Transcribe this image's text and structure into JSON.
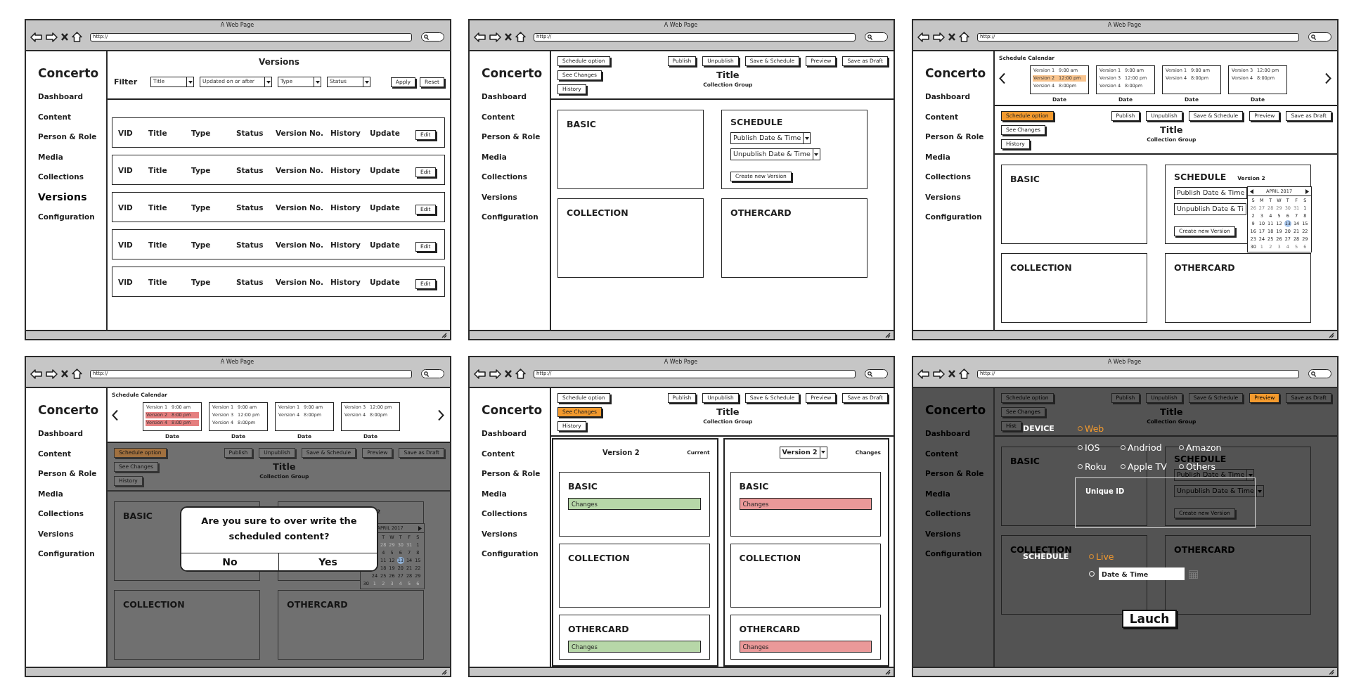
{
  "frames": [
    {
      "kind": "versions",
      "window_title": "A Web Page",
      "url": "http://",
      "sidebar": {
        "brand": "Concerto",
        "items": [
          {
            "label": "Dashboard",
            "selected": false
          },
          {
            "label": "Content",
            "selected": false
          },
          {
            "label": "Person & Role",
            "selected": false
          },
          {
            "label": "Media",
            "selected": false
          },
          {
            "label": "Collections",
            "selected": false
          },
          {
            "label": "Versions",
            "selected": true
          },
          {
            "label": "Configuration",
            "selected": false
          }
        ]
      },
      "header": {
        "title": "Versions",
        "filter_label": "Filter",
        "filters": [
          "Title",
          "Updated on or after",
          "Type",
          "Status"
        ],
        "buttons": [
          "Apply",
          "Reset"
        ]
      },
      "rows": [
        {
          "cells": [
            "VID",
            "Title",
            "Type",
            "Status",
            "Version No.",
            "History",
            "Update"
          ],
          "action": "Edit"
        },
        {
          "cells": [
            "VID",
            "Title",
            "Type",
            "Status",
            "Version No.",
            "History",
            "Update"
          ],
          "action": "Edit"
        },
        {
          "cells": [
            "VID",
            "Title",
            "Type",
            "Status",
            "Version No.",
            "History",
            "Update"
          ],
          "action": "Edit"
        },
        {
          "cells": [
            "VID",
            "Title",
            "Type",
            "Status",
            "Version No.",
            "History",
            "Update"
          ],
          "action": "Edit"
        },
        {
          "cells": [
            "VID",
            "Title",
            "Type",
            "Status",
            "Version No.",
            "History",
            "Update"
          ],
          "action": "Edit"
        }
      ]
    },
    {
      "kind": "editor",
      "window_title": "A Web Page",
      "url": "http://",
      "sidebar": {
        "brand": "Concerto",
        "items": [
          {
            "label": "Dashboard",
            "selected": false
          },
          {
            "label": "Content",
            "selected": false
          },
          {
            "label": "Person & Role",
            "selected": false
          },
          {
            "label": "Media",
            "selected": false
          },
          {
            "label": "Collections",
            "selected": false
          },
          {
            "label": "Versions",
            "selected": false
          },
          {
            "label": "Configuration",
            "selected": false
          }
        ]
      },
      "toolbar": {
        "left_buttons": [
          {
            "label": "Schedule option",
            "highlighted": false
          },
          {
            "label": "See Changes",
            "highlighted": false
          },
          {
            "label": "History",
            "highlighted": false
          }
        ],
        "right_buttons": [
          {
            "label": "Publish",
            "highlighted": false
          },
          {
            "label": "Unpublish",
            "highlighted": false
          },
          {
            "label": "Save & Schedule",
            "highlighted": false
          },
          {
            "label": "Preview",
            "highlighted": false
          },
          {
            "label": "Save as Draft",
            "highlighted": false
          }
        ],
        "title": "Title",
        "subtitle": "Collection Group"
      },
      "cards": [
        {
          "kind": "plain",
          "title": "BASIC"
        },
        {
          "kind": "schedule",
          "title": "SCHEDULE",
          "dropdowns": [
            "Publish Date & Time",
            "Unpublish Date & Time"
          ],
          "button": "Create new Version"
        },
        {
          "kind": "plain",
          "title": "COLLECTION"
        },
        {
          "kind": "plain",
          "title": "OTHERCARD"
        }
      ]
    },
    {
      "kind": "editor",
      "window_title": "A Web Page",
      "url": "http://",
      "sidebar": {
        "brand": "Concerto",
        "items": [
          {
            "label": "Dashboard",
            "selected": false
          },
          {
            "label": "Content",
            "selected": false
          },
          {
            "label": "Person & Role",
            "selected": false
          },
          {
            "label": "Media",
            "selected": false
          },
          {
            "label": "Collections",
            "selected": false
          },
          {
            "label": "Versions",
            "selected": false
          },
          {
            "label": "Configuration",
            "selected": false
          }
        ]
      },
      "schedule_calendar": {
        "title": "Schedule Calendar",
        "days": [
          {
            "label": "Date",
            "entries": [
              {
                "version": "Version 1",
                "time": "9:00 am"
              },
              {
                "version": "Version 2",
                "time": "12:00 pm",
                "color": "#f9c48e"
              },
              {
                "version": "Version 4",
                "time": "8:00pm"
              }
            ]
          },
          {
            "label": "Date",
            "entries": [
              {
                "version": "Version 1",
                "time": "9:00 am"
              },
              {
                "version": "Version 3",
                "time": "12:00 pm"
              },
              {
                "version": "Version 4",
                "time": "8:00pm"
              }
            ]
          },
          {
            "label": "Date",
            "entries": [
              {
                "version": "Version 1",
                "time": "9:00 am"
              },
              {
                "version": "Version 4",
                "time": "8:00pm"
              }
            ]
          },
          {
            "label": "Date",
            "entries": [
              {
                "version": "Version 3",
                "time": "12:00 pm"
              },
              {
                "version": "Version 4",
                "time": "8:00pm"
              }
            ]
          }
        ]
      },
      "toolbar": {
        "left_buttons": [
          {
            "label": "Schedule option",
            "highlighted": true
          },
          {
            "label": "See Changes",
            "highlighted": false
          },
          {
            "label": "History",
            "highlighted": false
          }
        ],
        "right_buttons": [
          {
            "label": "Publish",
            "highlighted": false
          },
          {
            "label": "Unpublish",
            "highlighted": false
          },
          {
            "label": "Save & Schedule",
            "highlighted": false
          },
          {
            "label": "Preview",
            "highlighted": false
          },
          {
            "label": "Save as Draft",
            "highlighted": false
          }
        ],
        "title": "Title",
        "subtitle": "Collection Group"
      },
      "cards": [
        {
          "kind": "plain",
          "title": "BASIC"
        },
        {
          "kind": "schedule",
          "title": "SCHEDULE",
          "version": "Version 2",
          "dropdowns": [
            "Publish Date & Time",
            "Unpublish Date & Ti"
          ],
          "button": "Create new Version",
          "date_picker": {
            "month": "APRIL 2017",
            "previous_arrow": true,
            "next_arrow": true,
            "weekdays": [
              "S",
              "M",
              "T",
              "W",
              "T",
              "F",
              "S"
            ],
            "weeks": [
              [
                {
                  "day": "26",
                  "outside": true,
                  "selected": false
                },
                {
                  "day": "27",
                  "outside": true,
                  "selected": false
                },
                {
                  "day": "28",
                  "outside": true,
                  "selected": false
                },
                {
                  "day": "29",
                  "outside": true,
                  "selected": false
                },
                {
                  "day": "30",
                  "outside": true,
                  "selected": false
                },
                {
                  "day": "31",
                  "outside": true,
                  "selected": false
                },
                {
                  "day": "1",
                  "outside": false,
                  "selected": false
                }
              ],
              [
                {
                  "day": "2",
                  "outside": false,
                  "selected": false
                },
                {
                  "day": "3",
                  "outside": false,
                  "selected": false
                },
                {
                  "day": "4",
                  "outside": false,
                  "selected": false
                },
                {
                  "day": "5",
                  "outside": false,
                  "selected": false
                },
                {
                  "day": "6",
                  "outside": false,
                  "selected": false
                },
                {
                  "day": "7",
                  "outside": false,
                  "selected": false
                },
                {
                  "day": "8",
                  "outside": false,
                  "selected": false
                }
              ],
              [
                {
                  "day": "9",
                  "outside": false,
                  "selected": false
                },
                {
                  "day": "10",
                  "outside": false,
                  "selected": false
                },
                {
                  "day": "11",
                  "outside": false,
                  "selected": false
                },
                {
                  "day": "12",
                  "outside": false,
                  "selected": false
                },
                {
                  "day": "13",
                  "outside": false,
                  "selected": true
                },
                {
                  "day": "14",
                  "outside": false,
                  "selected": false
                },
                {
                  "day": "15",
                  "outside": false,
                  "selected": false
                }
              ],
              [
                {
                  "day": "16",
                  "outside": false,
                  "selected": false
                },
                {
                  "day": "17",
                  "outside": false,
                  "selected": false
                },
                {
                  "day": "18",
                  "outside": false,
                  "selected": false
                },
                {
                  "day": "19",
                  "outside": false,
                  "selected": false
                },
                {
                  "day": "20",
                  "outside": false,
                  "selected": false
                },
                {
                  "day": "21",
                  "outside": false,
                  "selected": false
                },
                {
                  "day": "22",
                  "outside": false,
                  "selected": false
                }
              ],
              [
                {
                  "day": "23",
                  "outside": false,
                  "selected": false
                },
                {
                  "day": "24",
                  "outside": false,
                  "selected": false
                },
                {
                  "day": "25",
                  "outside": false,
                  "selected": false
                },
                {
                  "day": "26",
                  "outside": false,
                  "selected": false
                },
                {
                  "day": "27",
                  "outside": false,
                  "selected": false
                },
                {
                  "day": "28",
                  "outside": false,
                  "selected": false
                },
                {
                  "day": "29",
                  "outside": false,
                  "selected": false
                }
              ],
              [
                {
                  "day": "30",
                  "outside": false,
                  "selected": false
                },
                {
                  "day": "1",
                  "outside": true,
                  "selected": false
                },
                {
                  "day": "2",
                  "outside": true,
                  "selected": false
                },
                {
                  "day": "3",
                  "outside": true,
                  "selected": false
                },
                {
                  "day": "4",
                  "outside": true,
                  "selected": false
                },
                {
                  "day": "5",
                  "outside": true,
                  "selected": false
                },
                {
                  "day": "6",
                  "outside": true,
                  "selected": false
                }
              ]
            ]
          }
        },
        {
          "kind": "plain",
          "title": "COLLECTION"
        },
        {
          "kind": "plain",
          "title": "OTHERCARD"
        }
      ]
    },
    {
      "kind": "editor",
      "editor_dimmed": true,
      "window_title": "A Web Page",
      "url": "http://",
      "sidebar": {
        "brand": "Concerto",
        "items": [
          {
            "label": "Dashboard",
            "selected": false
          },
          {
            "label": "Content",
            "selected": false
          },
          {
            "label": "Person & Role",
            "selected": false
          },
          {
            "label": "Media",
            "selected": false
          },
          {
            "label": "Collections",
            "selected": false
          },
          {
            "label": "Versions",
            "selected": false
          },
          {
            "label": "Configuration",
            "selected": false
          }
        ]
      },
      "schedule_calendar": {
        "title": "Schedule Calendar",
        "days": [
          {
            "label": "Date",
            "entries": [
              {
                "version": "Version 1",
                "time": "9:00 am"
              },
              {
                "version": "Version 2",
                "time": "8:00 pm",
                "color": "#e57f7f"
              },
              {
                "version": "Version 4",
                "time": "8:00 pm",
                "color": "#e57f7f"
              }
            ]
          },
          {
            "label": "Date",
            "entries": [
              {
                "version": "Version 1",
                "time": "9:00 am"
              },
              {
                "version": "Version 3",
                "time": "12:00 pm"
              },
              {
                "version": "Version 4",
                "time": "8:00pm"
              }
            ]
          },
          {
            "label": "Date",
            "entries": [
              {
                "version": "Version 1",
                "time": "9:00 am"
              },
              {
                "version": "Version 4",
                "time": "8:00pm"
              }
            ]
          },
          {
            "label": "Date",
            "entries": [
              {
                "version": "Version 3",
                "time": "12:00 pm"
              },
              {
                "version": "Version 4",
                "time": "8:00pm"
              }
            ]
          }
        ]
      },
      "toolbar": {
        "left_buttons": [
          {
            "label": "Schedule option",
            "highlighted": true
          },
          {
            "label": "See Changes",
            "highlighted": false
          },
          {
            "label": "History",
            "highlighted": false
          }
        ],
        "right_buttons": [
          {
            "label": "Publish",
            "highlighted": false
          },
          {
            "label": "Unpublish",
            "highlighted": false
          },
          {
            "label": "Save & Schedule",
            "highlighted": false
          },
          {
            "label": "Preview",
            "highlighted": false
          },
          {
            "label": "Save as Draft",
            "highlighted": false
          }
        ],
        "title": "Title",
        "subtitle": "Collection Group"
      },
      "cards": [
        {
          "kind": "plain",
          "title": "BASIC"
        },
        {
          "kind": "schedule",
          "version": "2",
          "date_picker": {
            "month": "APRIL 2017",
            "previous_arrow": false,
            "next_arrow": true,
            "weekdays": [
              "T",
              "W",
              "T",
              "F",
              "S"
            ],
            "weeks": [
              [
                {
                  "day": "28",
                  "outside": true,
                  "selected": false
                },
                {
                  "day": "29",
                  "outside": true,
                  "selected": false
                },
                {
                  "day": "30",
                  "outside": true,
                  "selected": false
                },
                {
                  "day": "31",
                  "outside": true,
                  "selected": false
                },
                {
                  "day": "1",
                  "outside": false,
                  "selected": false
                }
              ],
              [
                {
                  "day": "4",
                  "outside": false,
                  "selected": false
                },
                {
                  "day": "5",
                  "outside": false,
                  "selected": false
                },
                {
                  "day": "6",
                  "outside": false,
                  "selected": false
                },
                {
                  "day": "7",
                  "outside": false,
                  "selected": false
                },
                {
                  "day": "8",
                  "outside": false,
                  "selected": false
                }
              ],
              [
                {
                  "day": "11",
                  "outside": false,
                  "selected": false
                },
                {
                  "day": "12",
                  "outside": false,
                  "selected": false
                },
                {
                  "day": "13",
                  "outside": false,
                  "selected": true
                },
                {
                  "day": "14",
                  "outside": false,
                  "selected": false
                },
                {
                  "day": "15",
                  "outside": false,
                  "selected": false
                }
              ],
              [
                {
                  "day": "18",
                  "outside": false,
                  "selected": false
                },
                {
                  "day": "19",
                  "outside": false,
                  "selected": false
                },
                {
                  "day": "20",
                  "outside": false,
                  "selected": false
                },
                {
                  "day": "21",
                  "outside": false,
                  "selected": false
                },
                {
                  "day": "22",
                  "outside": false,
                  "selected": false
                }
              ],
              [
                {
                  "day": "24",
                  "outside": false,
                  "selected": false
                },
                {
                  "day": "25",
                  "outside": false,
                  "selected": false
                },
                {
                  "day": "26",
                  "outside": false,
                  "selected": false
                },
                {
                  "day": "27",
                  "outside": false,
                  "selected": false
                },
                {
                  "day": "28",
                  "outside": false,
                  "selected": false
                },
                {
                  "day": "29",
                  "outside": false,
                  "selected": false
                }
              ],
              [
                {
                  "day": "30",
                  "outside": false,
                  "selected": false
                },
                {
                  "day": "1",
                  "outside": true,
                  "selected": false
                },
                {
                  "day": "2",
                  "outside": true,
                  "selected": false
                },
                {
                  "day": "3",
                  "outside": true,
                  "selected": false
                },
                {
                  "day": "4",
                  "outside": true,
                  "selected": false
                },
                {
                  "day": "5",
                  "outside": true,
                  "selected": false
                },
                {
                  "day": "6",
                  "outside": true,
                  "selected": false
                }
              ]
            ]
          }
        },
        {
          "kind": "plain",
          "title": "COLLECTION"
        },
        {
          "kind": "plain",
          "title": "OTHERCARD"
        }
      ],
      "dialog": {
        "message": "Are you sure to over write the scheduled content?",
        "buttons": [
          "No",
          "Yes"
        ]
      }
    },
    {
      "kind": "compare",
      "window_title": "A Web Page",
      "url": "http://",
      "sidebar": {
        "brand": "Concerto",
        "items": [
          {
            "label": "Dashboard",
            "selected": false
          },
          {
            "label": "Content",
            "selected": false
          },
          {
            "label": "Person & Role",
            "selected": false
          },
          {
            "label": "Media",
            "selected": false
          },
          {
            "label": "Collections",
            "selected": false
          },
          {
            "label": "Versions",
            "selected": false
          },
          {
            "label": "Configuration",
            "selected": false
          }
        ]
      },
      "toolbar": {
        "left_buttons": [
          {
            "label": "Schedule option",
            "highlighted": false
          },
          {
            "label": "See Changes",
            "highlighted": true
          },
          {
            "label": "History",
            "highlighted": false
          }
        ],
        "right_buttons": [
          {
            "label": "Publish",
            "highlighted": false
          },
          {
            "label": "Unpublish",
            "highlighted": false
          },
          {
            "label": "Save & Schedule",
            "highlighted": false
          },
          {
            "label": "Preview",
            "highlighted": false
          },
          {
            "label": "Save as Draft",
            "highlighted": false
          }
        ],
        "title": "Title",
        "subtitle": "Collection Group"
      },
      "columns": [
        {
          "kind": "text",
          "heading": "Version 2",
          "note": "Current",
          "cards": [
            {
              "title": "BASIC",
              "change": {
                "label": "Changes",
                "color": "#b7d7a8"
              }
            },
            {
              "title": "COLLECTION"
            },
            {
              "title": "OTHERCARD",
              "change": {
                "label": "Changes",
                "color": "#b7d7a8"
              }
            }
          ]
        },
        {
          "kind": "dropdown",
          "heading": "Version 2",
          "note": "Changes",
          "cards": [
            {
              "title": "BASIC",
              "change": {
                "label": "Changes",
                "color": "#ea9999"
              }
            },
            {
              "title": "COLLECTION"
            },
            {
              "title": "OTHERCARD",
              "change": {
                "label": "Changes",
                "color": "#ea9999"
              }
            }
          ]
        }
      ]
    },
    {
      "kind": "editor",
      "page_dimmed": true,
      "window_title": "A Web Page",
      "url": "http://",
      "sidebar": {
        "brand": "Concerto",
        "items": [
          {
            "label": "Dashboard",
            "selected": false
          },
          {
            "label": "Content",
            "selected": false
          },
          {
            "label": "Person & Role",
            "selected": false
          },
          {
            "label": "Media",
            "selected": false
          },
          {
            "label": "Collections",
            "selected": false
          },
          {
            "label": "Versions",
            "selected": false
          },
          {
            "label": "Configuration",
            "selected": false
          }
        ]
      },
      "toolbar": {
        "left_buttons": [
          {
            "label": "Schedule option",
            "highlighted": false
          },
          {
            "label": "See Changes",
            "highlighted": false
          },
          {
            "label": "Hist",
            "highlighted": false
          }
        ],
        "right_buttons": [
          {
            "label": "Publish",
            "highlighted": false
          },
          {
            "label": "Unpublish",
            "highlighted": false
          },
          {
            "label": "Save & Schedule",
            "highlighted": false
          },
          {
            "label": "Preview",
            "highlighted": true
          },
          {
            "label": "Save as Draft",
            "highlighted": false
          }
        ],
        "title": "Title",
        "subtitle": "Collection Group"
      },
      "cards": [
        {
          "kind": "plain",
          "title": "BASIC"
        },
        {
          "kind": "schedule",
          "title": "SCHEDULE",
          "dropdowns": [
            "Publish Date & Time",
            "Unpublish Date & Time"
          ],
          "button": "Create new Version"
        },
        {
          "kind": "plain",
          "title": "COLLECTION"
        },
        {
          "kind": "plain",
          "title": "OTHERCARD"
        }
      ],
      "launch": {
        "device_label": "DEVICE",
        "devices": [
          {
            "label": "Web",
            "selected": true
          },
          {
            "label": "IOS",
            "selected": false
          },
          {
            "label": "Andriod",
            "selected": false
          },
          {
            "label": "Amazon",
            "selected": false
          },
          {
            "label": "Roku",
            "selected": false
          },
          {
            "label": "Apple TV",
            "selected": false
          },
          {
            "label": "Others",
            "selected": false
          }
        ],
        "unique_id_label": "Unique ID",
        "schedule_label": "SCHEDULE",
        "schedule_options": [
          {
            "kind": "option",
            "label": "Live",
            "selected": true
          },
          {
            "kind": "field",
            "value": "Date & Time",
            "selected": false
          }
        ],
        "button": "Lauch"
      }
    }
  ]
}
